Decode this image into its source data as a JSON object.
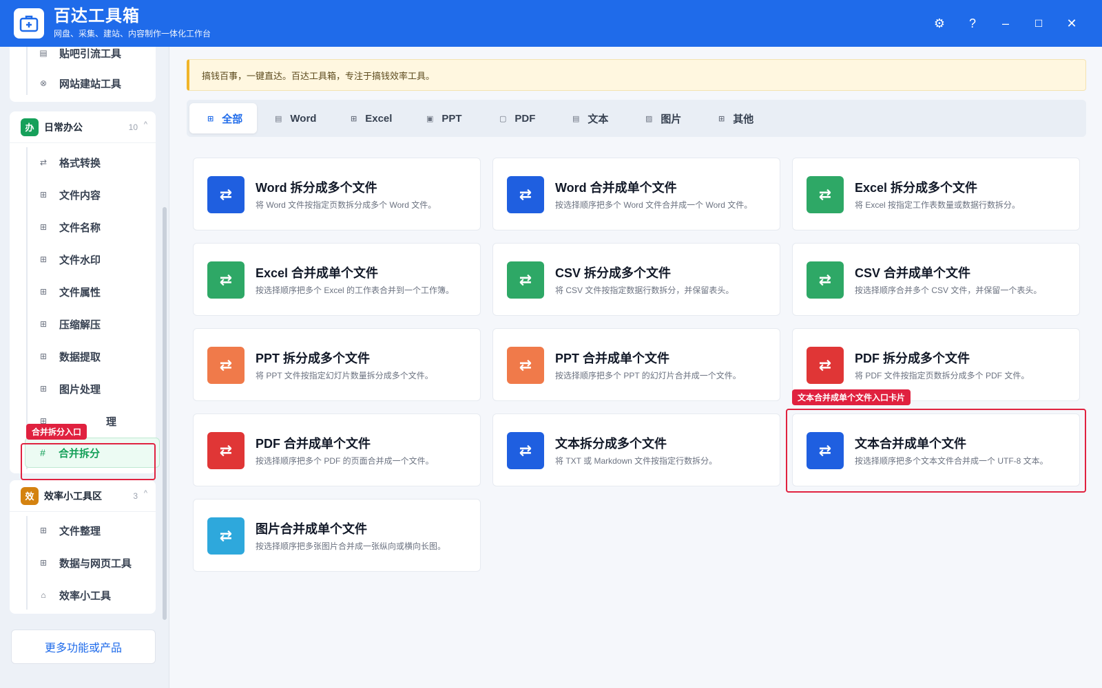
{
  "app": {
    "title": "百达工具箱",
    "subtitle": "网盘、采集、建站、内容制作一体化工作台"
  },
  "window_controls": {
    "settings": "⚙",
    "help": "?",
    "minimize": "–",
    "maximize": "☐",
    "close": "✕"
  },
  "sidebar": {
    "top_items": [
      {
        "label": "贴吧引流工具",
        "icon": "document-icon"
      },
      {
        "label": "网站建站工具",
        "icon": "globe-icon"
      }
    ],
    "group_office": {
      "badge": "办",
      "title": "日常办公",
      "count": "10",
      "caret": "^",
      "items": [
        {
          "label": "格式转换",
          "glyph": "⇄"
        },
        {
          "label": "文件内容",
          "glyph": "⊞"
        },
        {
          "label": "文件名称",
          "glyph": "⊞"
        },
        {
          "label": "文件水印",
          "glyph": "⊞"
        },
        {
          "label": "文件属性",
          "glyph": "⊞"
        },
        {
          "label": "压缩解压",
          "glyph": "⊞"
        },
        {
          "label": "数据提取",
          "glyph": "⊞"
        },
        {
          "label": "图片处理",
          "glyph": "⊞"
        },
        {
          "label": "理",
          "glyph": "⊞"
        }
      ],
      "active_item": {
        "label": "合并拆分",
        "glyph": "#"
      }
    },
    "group_efficiency": {
      "badge": "效",
      "title": "效率小工具区",
      "count": "3",
      "caret": "^",
      "items": [
        {
          "label": "文件整理",
          "glyph": "⊞"
        },
        {
          "label": "数据与网页工具",
          "glyph": "⊞"
        },
        {
          "label": "效率小工具",
          "glyph": "⌂"
        }
      ]
    },
    "more_button": "更多功能或产品"
  },
  "annotations": {
    "sidebar_tag": "合并拆分入口",
    "card_tag": "文本合并成单个文件入口卡片"
  },
  "notice": "搞钱百事，一键直达。百达工具箱，专注于搞钱效率工具。",
  "tabs": [
    {
      "label": "全部",
      "glyph": "⊞",
      "active": true
    },
    {
      "label": "Word",
      "glyph": "▤",
      "active": false
    },
    {
      "label": "Excel",
      "glyph": "⊞",
      "active": false
    },
    {
      "label": "PPT",
      "glyph": "▣",
      "active": false
    },
    {
      "label": "PDF",
      "glyph": "▢",
      "active": false
    },
    {
      "label": "文本",
      "glyph": "▤",
      "active": false
    },
    {
      "label": "图片",
      "glyph": "▨",
      "active": false
    },
    {
      "label": "其他",
      "glyph": "⊞",
      "active": false
    }
  ],
  "cards": [
    {
      "title": "Word 拆分成多个文件",
      "desc": "将 Word 文件按指定页数拆分成多个 Word 文件。",
      "color": "#1f5fe0",
      "icon": "swap-icon"
    },
    {
      "title": "Word 合并成单个文件",
      "desc": "按选择顺序把多个 Word 文件合并成一个 Word 文件。",
      "color": "#1f5fe0",
      "icon": "swap-icon"
    },
    {
      "title": "Excel 拆分成多个文件",
      "desc": "将 Excel 按指定工作表数量或数据行数拆分。",
      "color": "#2ea866",
      "icon": "swap-icon"
    },
    {
      "title": "Excel 合并成单个文件",
      "desc": "按选择顺序把多个 Excel 的工作表合并到一个工作簿。",
      "color": "#2ea866",
      "icon": "swap-icon"
    },
    {
      "title": "CSV 拆分成多个文件",
      "desc": "将 CSV 文件按指定数据行数拆分，并保留表头。",
      "color": "#2ea866",
      "icon": "swap-icon"
    },
    {
      "title": "CSV 合并成单个文件",
      "desc": "按选择顺序合并多个 CSV 文件，并保留一个表头。",
      "color": "#2ea866",
      "icon": "swap-icon"
    },
    {
      "title": "PPT 拆分成多个文件",
      "desc": "将 PPT 文件按指定幻灯片数量拆分成多个文件。",
      "color": "#f07a4a",
      "icon": "swap-icon"
    },
    {
      "title": "PPT 合并成单个文件",
      "desc": "按选择顺序把多个 PPT 的幻灯片合并成一个文件。",
      "color": "#f07a4a",
      "icon": "swap-icon"
    },
    {
      "title": "PDF 拆分成多个文件",
      "desc": "将 PDF 文件按指定页数拆分成多个 PDF 文件。",
      "color": "#e03636",
      "icon": "swap-icon"
    },
    {
      "title": "PDF 合并成单个文件",
      "desc": "按选择顺序把多个 PDF 的页面合并成一个文件。",
      "color": "#e03636",
      "icon": "swap-icon"
    },
    {
      "title": "文本拆分成多个文件",
      "desc": "将 TXT 或 Markdown 文件按指定行数拆分。",
      "color": "#1f5fe0",
      "icon": "swap-icon"
    },
    {
      "title": "文本合并成单个文件",
      "desc": "按选择顺序把多个文本文件合并成一个 UTF-8 文本。",
      "color": "#1f5fe0",
      "icon": "swap-icon"
    },
    {
      "title": "图片合并成单个文件",
      "desc": "按选择顺序把多张图片合并成一张纵向或横向长图。",
      "color": "#2ea8dc",
      "icon": "swap-icon"
    }
  ],
  "card_glyph": "⇄"
}
